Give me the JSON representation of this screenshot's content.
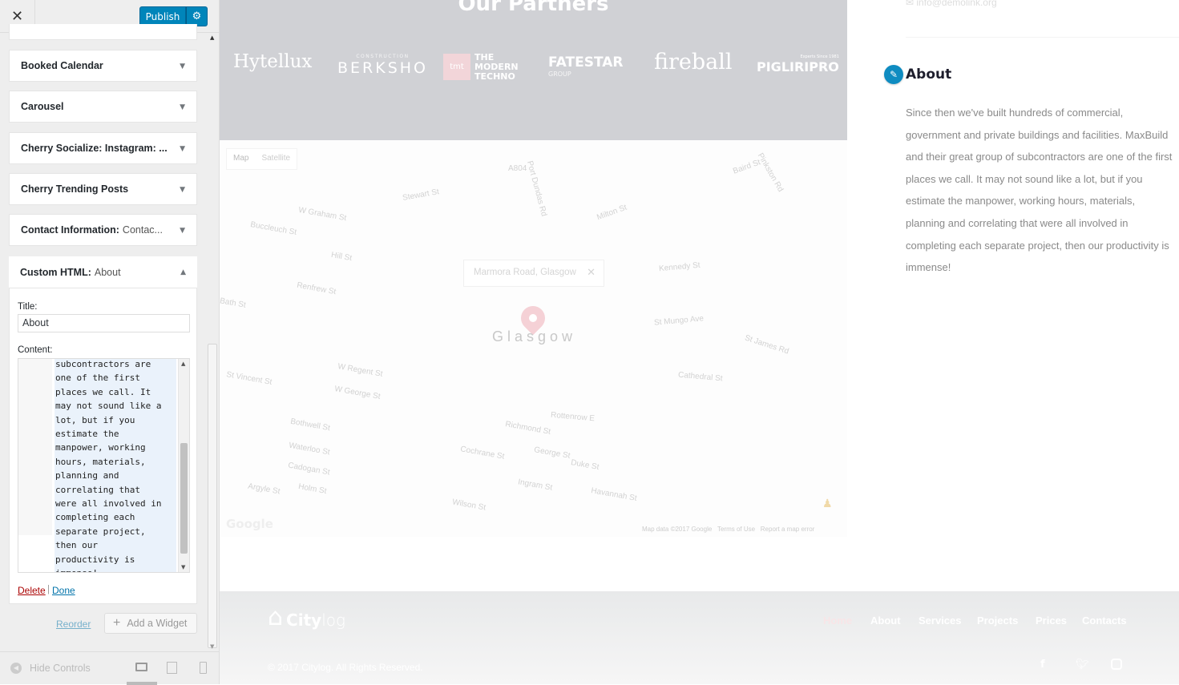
{
  "header": {
    "close_icon": "close-icon",
    "publish_label": "Publish",
    "settings_icon": "gear-icon"
  },
  "widgets": [
    {
      "title": "Booked Calendar",
      "subtitle": ""
    },
    {
      "title": "Carousel",
      "subtitle": ""
    },
    {
      "title": "Cherry Socialize: Instagram: ...",
      "subtitle": ""
    },
    {
      "title": "Cherry Trending Posts",
      "subtitle": ""
    },
    {
      "title": "Contact Information:",
      "subtitle": "Contac..."
    }
  ],
  "open_widget": {
    "title": "Custom HTML:",
    "subtitle": "About",
    "title_label": "Title:",
    "title_value": "About",
    "content_label": "Content:",
    "content_visible": "subcontractors are\none of the first\nplaces we call. It\nmay not sound like a\nlot, but if you\nestimate the\nmanpower, working\nhours, materials,\nplanning and\ncorrelating that\nwere all involved in\ncompleting each\nseparate project,\nthen our\nproductivity is\nimmense!",
    "delete_label": "Delete",
    "separator": "|",
    "done_label": "Done"
  },
  "actions": {
    "reorder_label": "Reorder",
    "add_widget_label": "Add a Widget"
  },
  "footer": {
    "hide_controls_label": "Hide Controls",
    "devices": [
      "desktop",
      "tablet",
      "mobile"
    ]
  },
  "preview": {
    "partners_title": "Our Partners",
    "partners": [
      "Hytellux",
      "BERKSHO",
      "THE MODERN TECHNO",
      "FATESTAR",
      "fireball",
      "PIGLIRIPRO"
    ],
    "partner_extras": {
      "berksho_top": "CONSTRUCTION",
      "tmt": "tmt",
      "fatestar_sub": "GROUP",
      "pigliri_top": "Experts Since 1981"
    },
    "map": {
      "type_map": "Map",
      "type_satellite": "Satellite",
      "info": "Marmora Road, Glasgow",
      "city": "Glasgow",
      "attribution": "Map data ©2017 Google",
      "terms": "Terms of Use",
      "report": "Report a map error",
      "google": "Google",
      "streets": [
        "A804",
        "Stewart St",
        "W Graham St",
        "Buccleuch St",
        "Hill St",
        "Renfrew St",
        "Bath St",
        "Port Dundas Rd",
        "Milton St",
        "Kennedy St",
        "St Mungo Ave",
        "St James Rd",
        "Cathedral St",
        "W Regent St",
        "W George St",
        "St Vincent St",
        "Bothwell St",
        "Waterloo St",
        "Cadogan St",
        "Argyle St",
        "Cochrane St",
        "George St",
        "Duke St",
        "Ingram St",
        "Wilson St",
        "Holm St",
        "Baird St",
        "Pinkston Rd",
        "Rottenrow E",
        "Richmond St",
        "Havannah St"
      ]
    },
    "contact_email": "info@demolink.org",
    "about_title": "About",
    "about_text": "Since then we've built hundreds of commercial, government and private buildings and facilities. MaxBuild and their great group of subcontractors are one of the first places we call. It may not sound like a lot, but if you estimate the manpower, working hours, materials, planning and correlating that were all involved in completing each separate project, then our productivity is immense!",
    "site_logo_bold": "City",
    "site_logo_light": "log",
    "nav": [
      "Home",
      "About",
      "Services",
      "Projects",
      "Prices",
      "Contacts"
    ],
    "copyright": "© 2017 Citylog. All Rights Reserved.",
    "social": [
      "facebook-icon",
      "twitter-icon",
      "instagram-icon"
    ],
    "accent": "#0f8cc1",
    "pin_color": "#f2c6cc"
  }
}
